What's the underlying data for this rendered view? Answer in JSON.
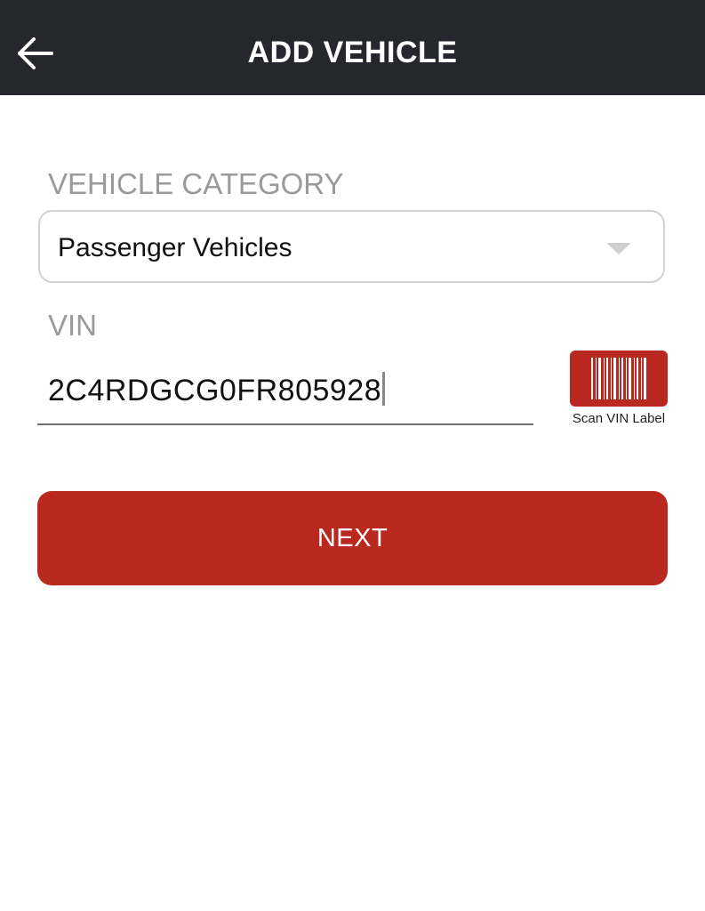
{
  "header": {
    "title": "ADD VEHICLE",
    "back_icon": "arrow-left-icon",
    "background_color": "#25262e"
  },
  "form": {
    "category_label": "VEHICLE CATEGORY",
    "category_value": "Passenger Vehicles",
    "vin_label": "VIN",
    "vin_value": "2C4RDGCG0FR805928",
    "scan_label": "Scan VIN Label",
    "scan_icon": "barcode-icon"
  },
  "actions": {
    "next_label": "NEXT",
    "accent_color": "#b9291f"
  }
}
